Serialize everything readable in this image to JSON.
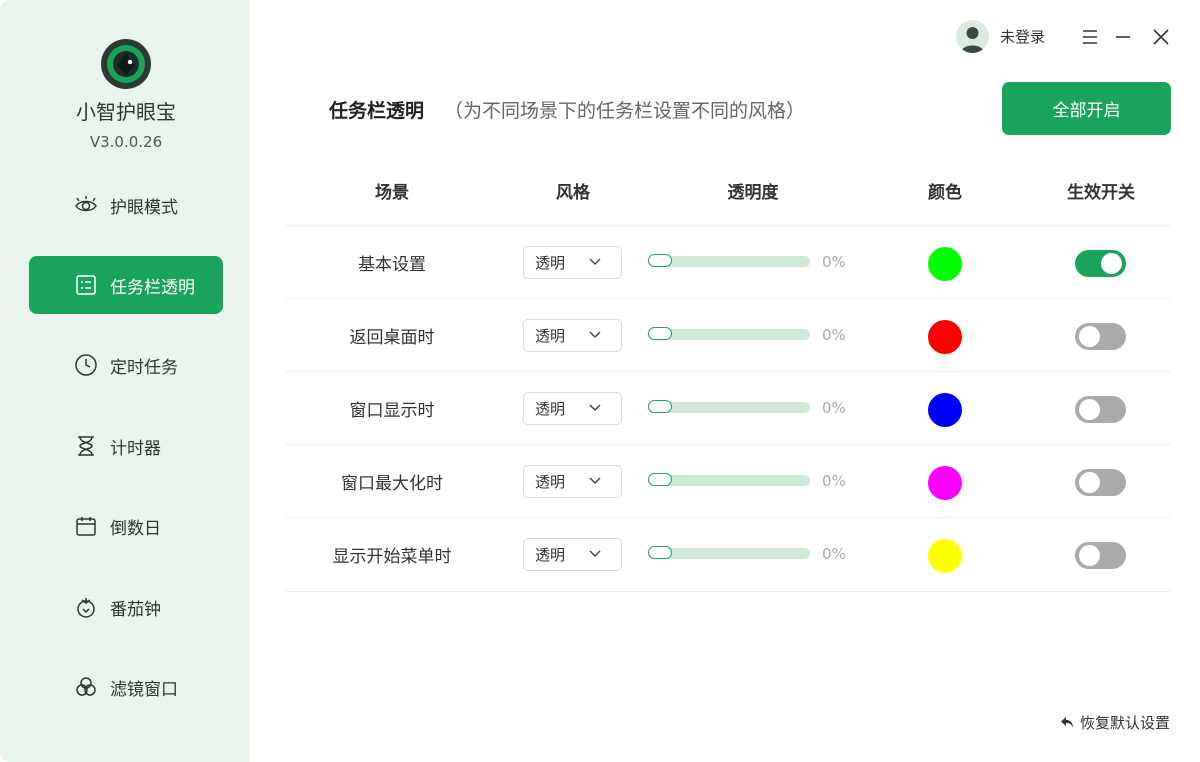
{
  "app": {
    "name": "小智护眼宝",
    "version": "V3.0.0.26"
  },
  "sidebar": {
    "items": [
      {
        "label": "护眼模式",
        "icon": "eye-icon"
      },
      {
        "label": "任务栏透明",
        "icon": "list-card-icon",
        "active": true
      },
      {
        "label": "定时任务",
        "icon": "clock-icon"
      },
      {
        "label": "计时器",
        "icon": "hourglass-icon"
      },
      {
        "label": "倒数日",
        "icon": "calendar-icon"
      },
      {
        "label": "番茄钟",
        "icon": "tomato-icon"
      },
      {
        "label": "滤镜窗口",
        "icon": "filter-circles-icon"
      }
    ]
  },
  "topbar": {
    "user_label": "未登录"
  },
  "header": {
    "title": "任务栏透明",
    "subtitle": "（为不同场景下的任务栏设置不同的风格）",
    "enable_all": "全部开启"
  },
  "table": {
    "columns": [
      "场景",
      "风格",
      "透明度",
      "颜色",
      "生效开关"
    ],
    "rows": [
      {
        "scene": "基本设置",
        "style": "透明",
        "opacity": "0%",
        "color": "#00ff00",
        "enabled": true
      },
      {
        "scene": "返回桌面时",
        "style": "透明",
        "opacity": "0%",
        "color": "#ff0000",
        "enabled": false
      },
      {
        "scene": "窗口显示时",
        "style": "透明",
        "opacity": "0%",
        "color": "#0000ff",
        "enabled": false
      },
      {
        "scene": "窗口最大化时",
        "style": "透明",
        "opacity": "0%",
        "color": "#ff00ff",
        "enabled": false
      },
      {
        "scene": "显示开始菜单时",
        "style": "透明",
        "opacity": "0%",
        "color": "#ffff00",
        "enabled": false
      }
    ]
  },
  "footer": {
    "restore_label": "恢复默认设置"
  },
  "colors": {
    "accent": "#1aa35a",
    "sidebar_bg": "#e9f4ec"
  }
}
